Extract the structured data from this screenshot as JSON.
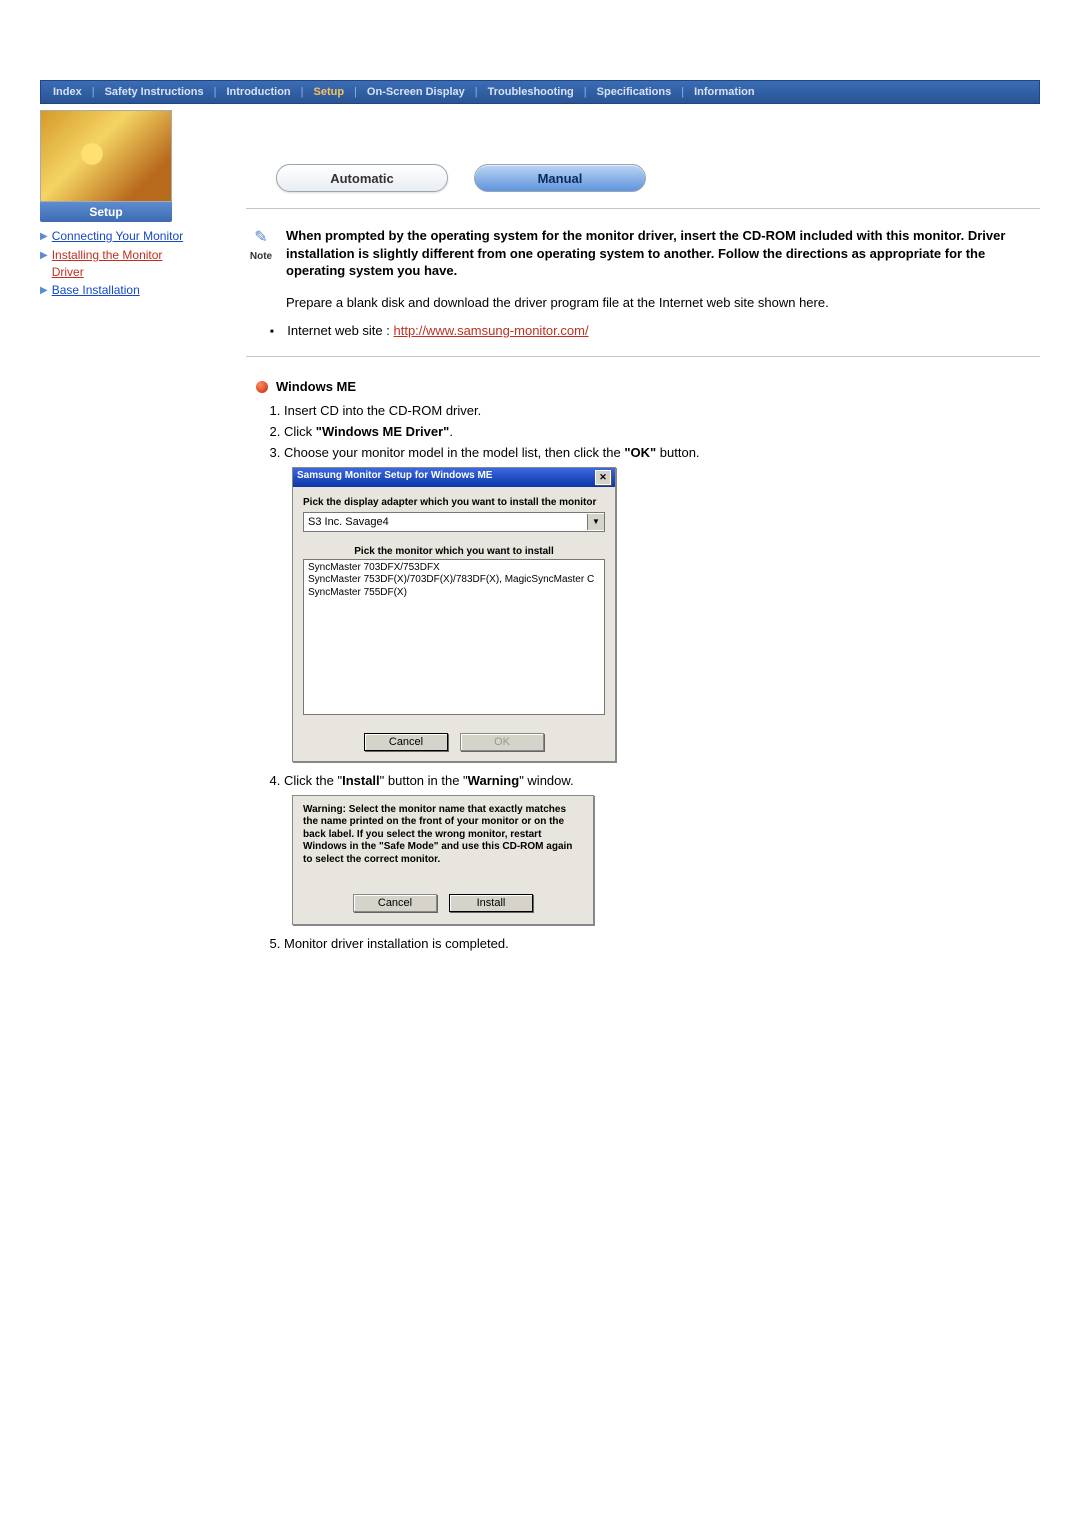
{
  "nav": {
    "index": "Index",
    "safety": "Safety Instructions",
    "intro": "Introduction",
    "setup": "Setup",
    "osd": "On-Screen Display",
    "trouble": "Troubleshooting",
    "specs": "Specifications",
    "info": "Information"
  },
  "sidebar": {
    "tab": "Setup",
    "link1": "Connecting Your Monitor",
    "link2": "Installing the Monitor Driver",
    "link3": "Base Installation"
  },
  "tabs": {
    "auto": "Automatic",
    "manual": "Manual"
  },
  "note": {
    "label": "Note",
    "bold": "When prompted by the operating system for the monitor driver, insert the CD-ROM included with this monitor. Driver installation is slightly different from one operating system to another. Follow the directions as appropriate for the operating system you have.",
    "prepare": "Prepare a blank disk and download the driver program file at the Internet web site shown here.",
    "bullet_label": "Internet web site : ",
    "url": "http://www.samsung-monitor.com/"
  },
  "section": {
    "title": "Windows ME",
    "step1": "Insert CD into the CD-ROM driver.",
    "step2a": "Click ",
    "step2b": "\"Windows ME Driver\"",
    "step2c": ".",
    "step3a": "Choose your monitor model in the model list, then click the ",
    "step3b": "\"OK\"",
    "step3c": " button.",
    "step4a": "Click the \"",
    "step4b": "Install",
    "step4c": "\" button in the \"",
    "step4d": "Warning",
    "step4e": "\" window.",
    "step5": "Monitor driver installation is completed."
  },
  "dlg1": {
    "title": "Samsung Monitor Setup for Windows  ME",
    "adapter_label": "Pick the display adapter which you want to install the monitor",
    "adapter_value": "S3 Inc. Savage4",
    "monitor_label": "Pick the monitor which you want to install",
    "item1": "SyncMaster 703DFX/753DFX",
    "item2": "SyncMaster 753DF(X)/703DF(X)/783DF(X), MagicSyncMaster C",
    "item3": "SyncMaster 755DF(X)",
    "cancel": "Cancel",
    "ok": "OK"
  },
  "dlg2": {
    "warn": "Warning: Select the monitor name that exactly matches the name printed on the front of your monitor or on the back label. If you select the wrong monitor, restart Windows in the \"Safe Mode\" and use this CD-ROM again to select the correct monitor.",
    "cancel": "Cancel",
    "install": "Install"
  }
}
